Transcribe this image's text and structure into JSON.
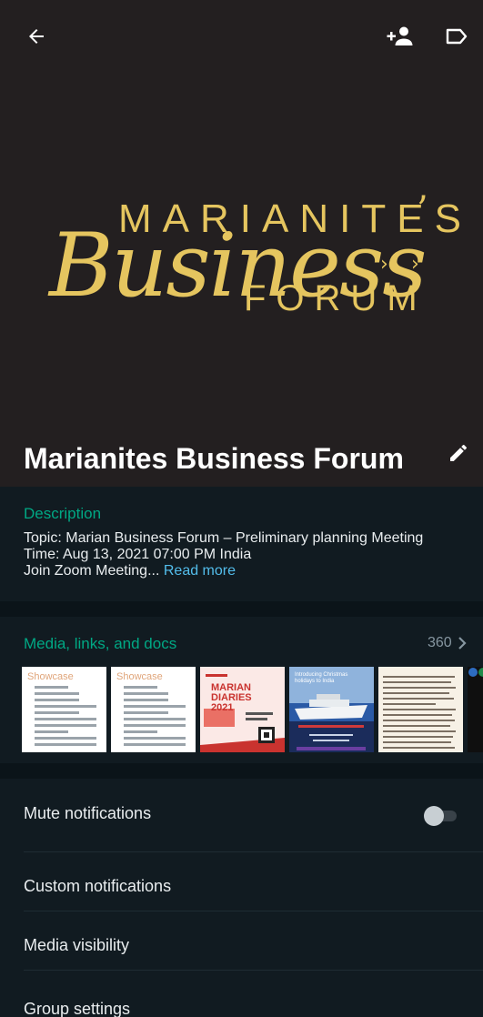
{
  "group": {
    "name": "Marianites Business Forum"
  },
  "logo": {
    "line1": "MARIANITES",
    "line2": "Business",
    "line3": "FORUM"
  },
  "description": {
    "heading": "Description",
    "topic": "Topic: Marian Business Forum – Preliminary planning Meeting",
    "time": "Time: Aug 13, 2021 07:00 PM India",
    "join": "Join Zoom Meeting...",
    "read_more": "Read more"
  },
  "media": {
    "heading": "Media, links, and docs",
    "count": "360",
    "thumbnails": [
      {
        "kind": "document",
        "heading": "Showcase"
      },
      {
        "kind": "document",
        "heading": "Showcase"
      },
      {
        "kind": "poster",
        "title": "MARIAN DIARIES 2021"
      },
      {
        "kind": "poster",
        "title": "Introducing Christmas holidays to India"
      },
      {
        "kind": "article"
      },
      {
        "kind": "partial"
      }
    ]
  },
  "settings": {
    "mute_label": "Mute notifications",
    "mute_on": false,
    "custom_label": "Custom notifications",
    "media_visibility_label": "Media visibility",
    "group_settings_label": "Group settings"
  },
  "colors": {
    "accent": "#00a884",
    "link": "#53bdeb",
    "logo_gold": "#e5c55f",
    "background": "#111b21"
  },
  "icons": {
    "back": "arrow-left-icon",
    "add_participant": "add-person-icon",
    "label": "label-tag-icon",
    "edit": "pencil-icon",
    "more": "chevron-right-icon"
  }
}
